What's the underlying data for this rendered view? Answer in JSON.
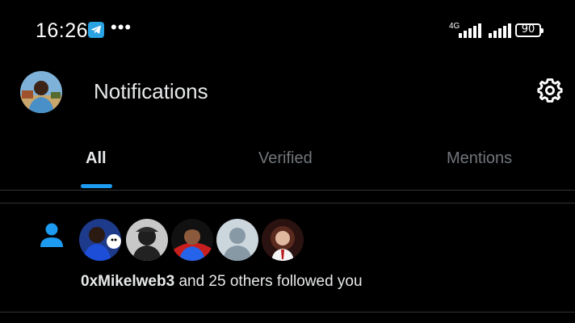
{
  "status_bar": {
    "time": "16:26",
    "more": "•••",
    "network": "4G",
    "battery": "90"
  },
  "header": {
    "title": "Notifications",
    "avatar": "profile-avatar",
    "settings_icon": "gear-icon"
  },
  "tabs": [
    {
      "label": "All",
      "active": true
    },
    {
      "label": "Verified",
      "active": false
    },
    {
      "label": "Mentions",
      "active": false
    }
  ],
  "notification": {
    "icon": "person-icon",
    "avatars": [
      "follower-avatar",
      "follower-avatar",
      "follower-avatar",
      "default-avatar",
      "follower-avatar"
    ],
    "username": "0xMikelweb3",
    "rest": " and 25 others followed you"
  },
  "colors": {
    "background": "#000000",
    "accent": "#1d9bf0",
    "text_primary": "#e7e9ea",
    "text_secondary": "#71767b",
    "divider": "#2f3336"
  }
}
